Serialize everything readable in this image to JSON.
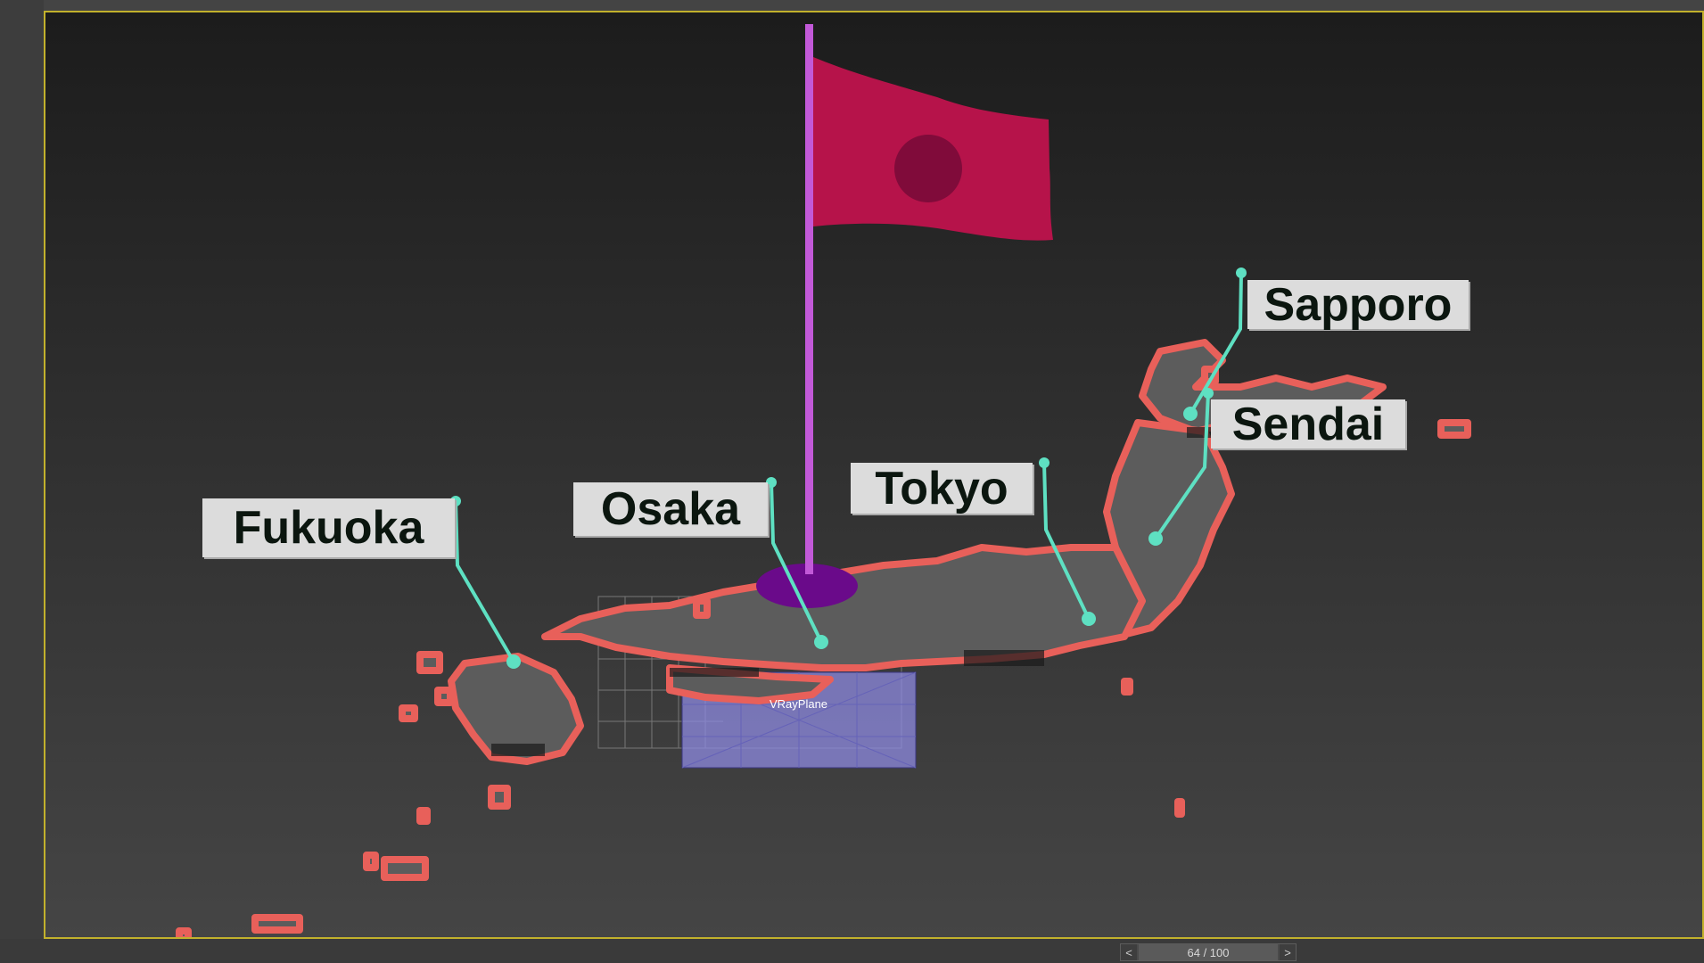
{
  "viewport": {
    "vray_plane_label": "VRayPlane"
  },
  "callouts": {
    "fukuoka": "Fukuoka",
    "osaka": "Osaka",
    "tokyo": "Tokyo",
    "sapporo": "Sapporo",
    "sendai": "Sendai"
  },
  "timeline": {
    "prev_label": "<",
    "next_label": ">",
    "frame_readout": "64 / 100",
    "current_frame": 64,
    "total_frames": 100
  },
  "colors": {
    "frame_border": "#c2b12c",
    "map_outline": "#e8605a",
    "map_fill": "#5c5c5c",
    "leader_line": "#5ee0c2",
    "flag": "#b6134a",
    "flag_pole": "#c259d8",
    "flag_base": "#6a0a8a",
    "plane": "#8d8ae0"
  }
}
